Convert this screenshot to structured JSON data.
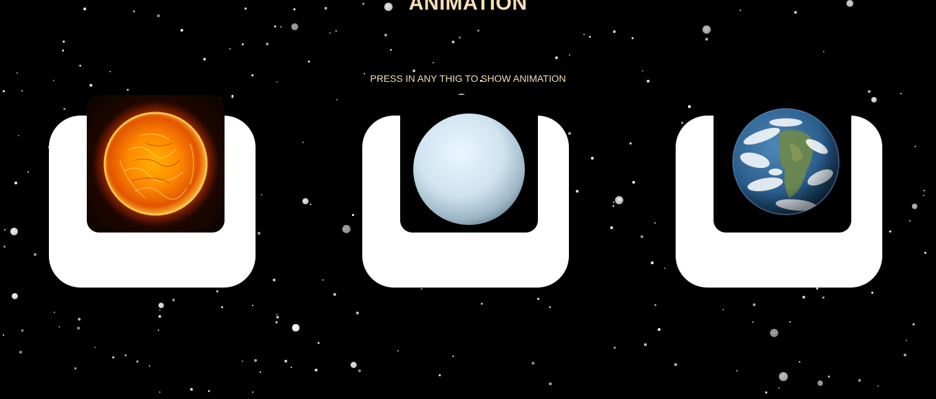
{
  "page": {
    "title": "ANIMATION",
    "instruction": "PRESS IN ANY THIG TO SHOW ANIMATION"
  },
  "cards": [
    {
      "id": "sun",
      "icon": "sun-icon"
    },
    {
      "id": "uranus",
      "icon": "planet-uranus-icon"
    },
    {
      "id": "earth",
      "icon": "planet-earth-icon"
    }
  ],
  "colors": {
    "background": "#000000",
    "card": "#ffffff",
    "text_accent": "#f6deb6"
  }
}
